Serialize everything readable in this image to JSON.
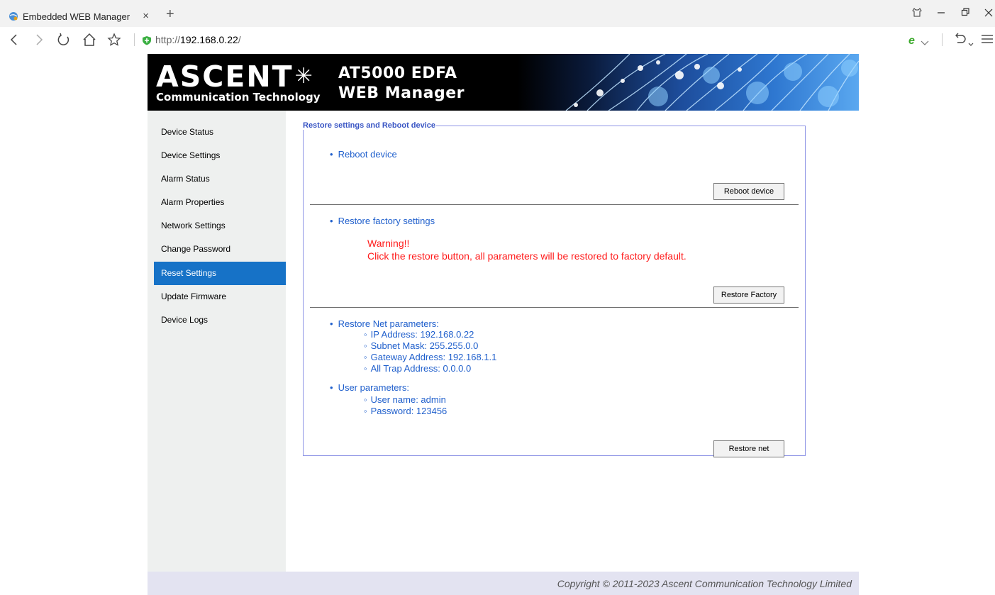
{
  "browser": {
    "tab_title": "Embedded WEB Manager",
    "tab_close": "×",
    "new_tab": "+",
    "url_prefix": "http://",
    "url_host": "192.168.0.22",
    "url_suffix": "/"
  },
  "banner": {
    "logo_text": "ASCENT",
    "logo_subtitle": "Communication Technology",
    "product_line1": "AT5000 EDFA",
    "product_line2": "WEB Manager"
  },
  "sidebar": {
    "items": [
      {
        "label": "Device Status"
      },
      {
        "label": "Device Settings"
      },
      {
        "label": "Alarm Status"
      },
      {
        "label": "Alarm Properties"
      },
      {
        "label": "Network Settings"
      },
      {
        "label": "Change Password"
      },
      {
        "label": "Reset Settings",
        "active": true
      },
      {
        "label": "Update Firmware"
      },
      {
        "label": "Device Logs"
      }
    ]
  },
  "panel": {
    "legend": "Restore settings and Reboot device",
    "reboot": {
      "title": "Reboot device",
      "button": "Reboot device"
    },
    "factory": {
      "title": "Restore factory settings",
      "warning_title": "Warning!!",
      "warning_text": "Click the restore button, all parameters will be restored to factory default.",
      "button": "Restore Factory"
    },
    "net": {
      "title": "Restore Net parameters:",
      "params": [
        "IP Address: 192.168.0.22",
        "Subnet Mask: 255.255.0.0",
        "Gateway Address: 192.168.1.1",
        "All Trap Address: 0.0.0.0"
      ],
      "user_title": "User parameters:",
      "user_params": [
        "User name: admin",
        "Password: 123456"
      ],
      "button": "Restore net"
    }
  },
  "footer": {
    "copyright": "Copyright © 2011-2023 Ascent Communication Technology Limited"
  },
  "colors": {
    "accent": "#1672c7",
    "link_blue": "#1f5fcc",
    "warning": "#ff1a1a",
    "fieldset_border": "#8f95e6"
  }
}
